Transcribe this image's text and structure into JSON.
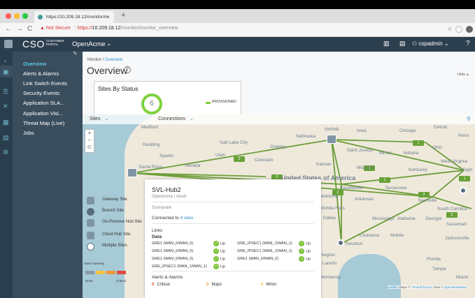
{
  "browser": {
    "tab_title": "https://10.209.18.12/monitor/m",
    "tab_close": "×",
    "new_tab": "+",
    "not_secure": "Not Secure",
    "url_scheme": "https://",
    "url_host": "10.209.18.12",
    "url_path": "/monitor/monitor_overview"
  },
  "app": {
    "logo_text": "CSO",
    "portal_line1": "CUSTOMER",
    "portal_line2": "PORTAL",
    "tenant": "OpenAcme",
    "user": "cspadmin",
    "help": "?"
  },
  "sidebar": {
    "items": [
      {
        "label": "Overview"
      },
      {
        "label": "Alerts & Alarms"
      },
      {
        "label": "Link Switch Events"
      },
      {
        "label": "Security Events"
      },
      {
        "label": "Application SLA..."
      },
      {
        "label": "Application Visi..."
      },
      {
        "label": "Threat Map (Live)"
      },
      {
        "label": "Jobs"
      }
    ]
  },
  "page": {
    "breadcrumb_root": "Monitor",
    "breadcrumb_sep": "/",
    "breadcrumb_current": "Overview",
    "title": "Overview",
    "hide": "Hide ▴"
  },
  "sites_card": {
    "title": "Sites By Status",
    "count": "6",
    "legend": "PROVISIONED",
    "color": "#7ed13b"
  },
  "map_controls": {
    "sites": "Sites",
    "connections": "Connections"
  },
  "map_labels": {
    "medford": "Medford",
    "redding": "Redding",
    "sparks": "Sparks",
    "nevada": "Nevada",
    "santa_rosa": "Santa Rosa",
    "utah": "Utah",
    "salt_lake": "Salt Lake City",
    "colorado": "Colorado",
    "greeley": "Greeley",
    "nebraska": "Nebraska",
    "norfolk": "Norfolk",
    "iowa": "Iowa",
    "chicago": "Chicago",
    "detroit": "Detroit",
    "kansas": "Kansas",
    "missouri": "Missouri",
    "illinois": "Illinois",
    "indiana": "Indiana",
    "ohio": "Ohio",
    "saint_joseph": "Saint Joseph",
    "west_virginia": "West Virginia",
    "kentucky": "Kentucky",
    "united_states": "United States of America",
    "tennessee": "Tennessee",
    "arkansas": "Arkansas",
    "oklahoma": "Oklahoma",
    "fayetteville": "Fayetteville",
    "wichita_falls": "Wichita Falls",
    "dallas": "Dallas",
    "mississippi": "Mississippi",
    "alabama": "Alabama",
    "georgia": "Georgia",
    "south_carolina": "South Carolina",
    "louisiana": "Louisiana",
    "houston": "Houston",
    "florida": "Florida",
    "jacksonville": "Jacksonville",
    "savannah": "Savannah",
    "mobile": "Mobile",
    "laredo": "Laredo",
    "monterrey": "Monterrey",
    "negras": "Negras",
    "nashville": "Nashville",
    "penn": "Penn",
    "virgin": "Virgin",
    "tampa": "Tampa",
    "miami": "Miami"
  },
  "link_badges": [
    "2",
    "2",
    "1",
    "1",
    "1",
    "2",
    "2",
    "1",
    "2"
  ],
  "legend": {
    "gateway": "Gateway Site",
    "branch": "Branch Site",
    "onprem": "On-Premise Hub Site",
    "cloud": "Cloud Hub Site",
    "multiple": "Multiple Sites",
    "severity_label": "Alarm Severity",
    "sev_none": "None",
    "sev_critical": "Critical",
    "sev_colors": [
      "#8a9aa7",
      "#f5c242",
      "#f0953c",
      "#e04a3c"
    ]
  },
  "popup": {
    "title": "SVL-Hub2",
    "subtitle": "OpenAcme | cloud",
    "location": "Sunnyvale",
    "connected_prefix": "Connected to",
    "connected_link": "4 sites",
    "links_heading": "Links",
    "data_heading": "Data",
    "links_col1": [
      {
        "name": "GRE1 (WAN_0/WAN_0)",
        "status": "Up"
      },
      {
        "name": "GRE1 (WAN_0/WAN_0)",
        "status": "Up"
      },
      {
        "name": "GRE1 (WAN_0/WAN_0)",
        "status": "Up"
      },
      {
        "name": "GRE_IPSEC1 (WAN_1/WAN_1)",
        "status": "Up"
      }
    ],
    "links_col2": [
      {
        "name": "GRE_IPSEC1 (WAN_1/WAN_1)",
        "status": "Up"
      },
      {
        "name": "GRE_IPSEC1 (WAN_1/WAN_1)",
        "status": "Up"
      },
      {
        "name": "GRE1 (WAN_0/WAN_0)",
        "status": "Up"
      }
    ],
    "alarms_heading": "Alerts & Alarms",
    "critical_count": "0",
    "critical_label": "Critical",
    "major_count": "0",
    "major_label": "Major",
    "minor_count": "0",
    "minor_label": "Minor"
  },
  "attribution": {
    "leaflet": "Leaflet",
    "sep1": "| Maps ©",
    "thunderforest": "Thunderforest",
    "sep2": "| Data ©",
    "osm": "OpenStreetMap"
  }
}
